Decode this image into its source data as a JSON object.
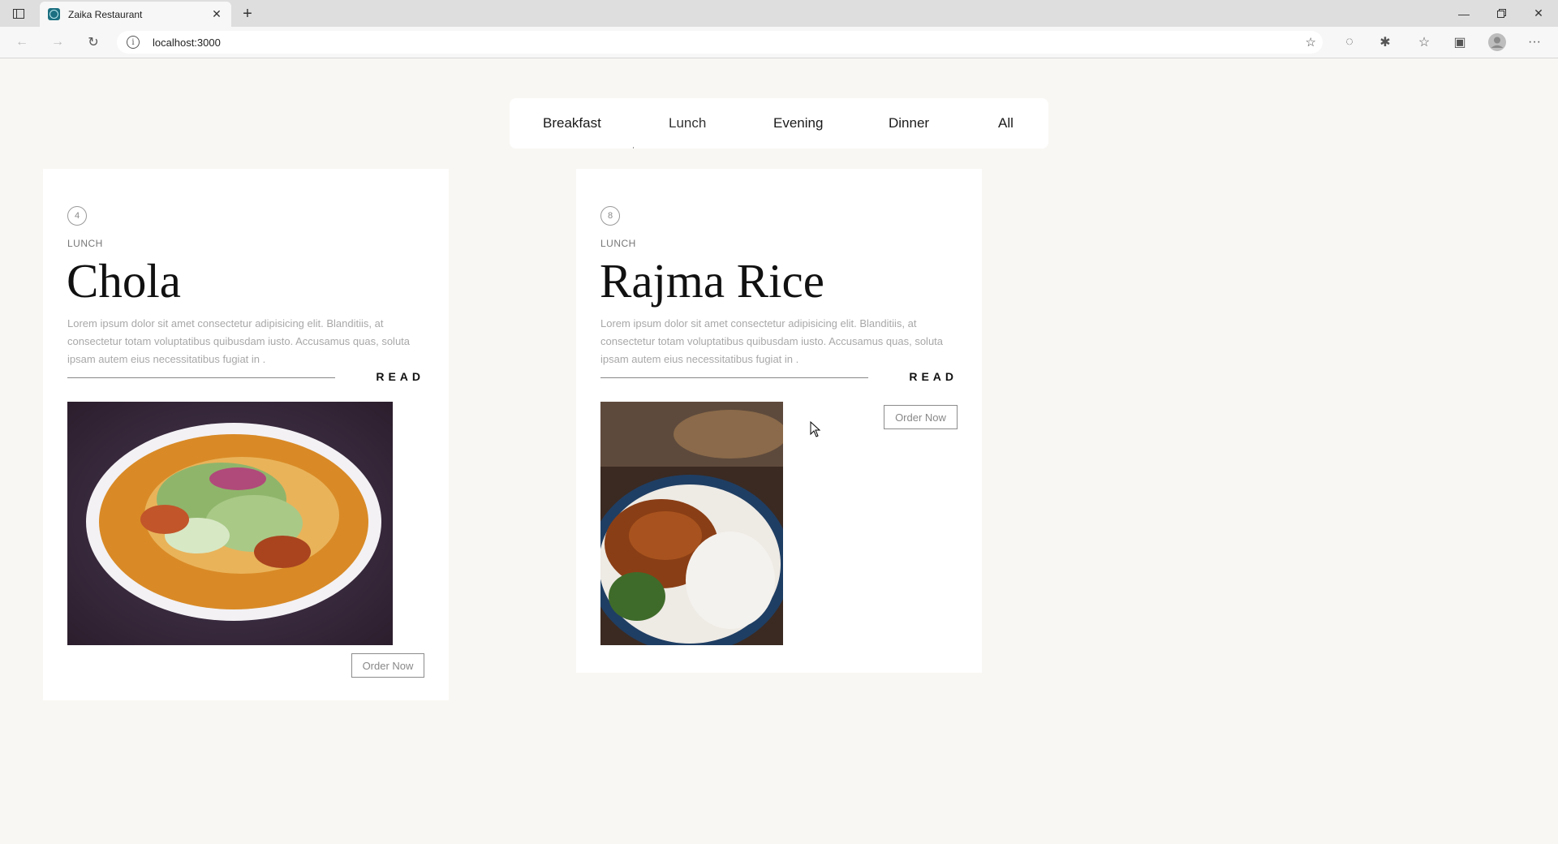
{
  "browser": {
    "tab_title": "Zaika Restaurant",
    "url": "localhost:3000"
  },
  "menu": {
    "tabs": [
      "Breakfast",
      "Lunch",
      "Evening",
      "Dinner",
      "All"
    ],
    "active": "Lunch"
  },
  "cards": [
    {
      "number": "4",
      "category": "LUNCH",
      "title": "Chola",
      "description": "Lorem ipsum dolor sit amet consectetur adipisicing elit. Blanditiis, at consectetur totam voluptatibus quibusdam iusto. Accusamus quas, soluta ipsam autem eius necessitatibus fugiat in .",
      "read_label": "READ",
      "order_label": "Order Now"
    },
    {
      "number": "8",
      "category": "LUNCH",
      "title": "Rajma Rice",
      "description": "Lorem ipsum dolor sit amet consectetur adipisicing elit. Blanditiis, at consectetur totam voluptatibus quibusdam iusto. Accusamus quas, soluta ipsam autem eius necessitatibus fugiat in .",
      "read_label": "READ",
      "order_label": "Order Now"
    }
  ],
  "colors": {
    "page_bg": "#f9f7f3",
    "card_bg": "#ffffff",
    "muted_text": "#a8a8a8"
  }
}
